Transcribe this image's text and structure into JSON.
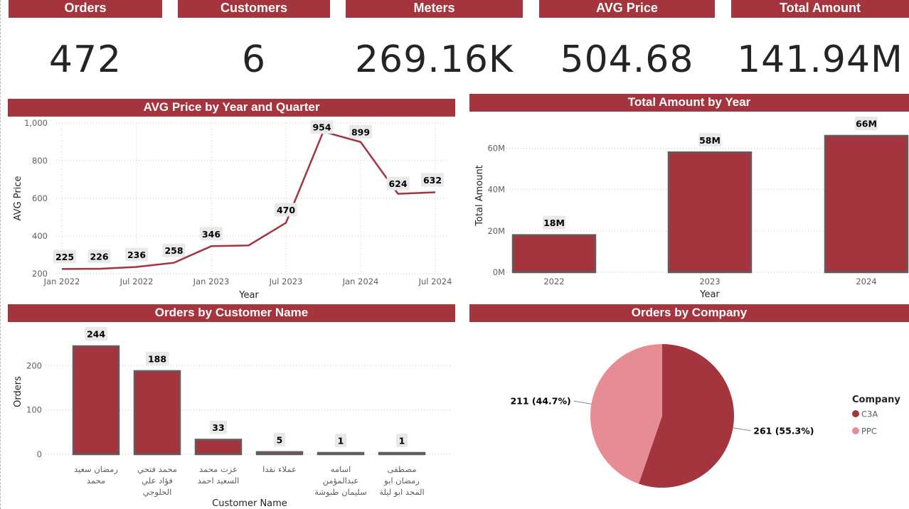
{
  "kpis": [
    {
      "label": "Orders",
      "value": "472"
    },
    {
      "label": "Customers",
      "value": "6"
    },
    {
      "label": "Meters",
      "value": "269.16K"
    },
    {
      "label": "AVG Price",
      "value": "504.68"
    },
    {
      "label": "Total Amount",
      "value": "141.94M"
    }
  ],
  "panels": {
    "avg_price_title": "AVG Price by Year and Quarter",
    "total_amount_title": "Total Amount by Year",
    "orders_customer_title": "Orders by Customer Name",
    "orders_company_title": "Orders by Company"
  },
  "colors": {
    "primary": "#a4343e",
    "secondary": "#e68c94",
    "bar_border": "#605e5c"
  },
  "chart_data": [
    {
      "id": "avg_price",
      "type": "line",
      "title": "AVG Price by Year and Quarter",
      "xlabel": "Year",
      "ylabel": "AVG Price",
      "x_ticks": [
        "Jan 2022",
        "Jul 2022",
        "Jan 2023",
        "Jul 2023",
        "Jan 2024",
        "Jul 2024"
      ],
      "y_ticks": [
        "200",
        "400",
        "600",
        "800",
        "1,000"
      ],
      "ylim": [
        200,
        1000
      ],
      "series": [
        {
          "values": [
            225,
            226,
            236,
            258,
            346,
            350,
            470,
            954,
            899,
            624,
            632
          ]
        }
      ],
      "labels": [
        "225",
        "226",
        "236",
        "258",
        "346",
        "",
        "470",
        "954",
        "899",
        "624",
        "632"
      ],
      "grid": true
    },
    {
      "id": "total_amount",
      "type": "bar",
      "title": "Total Amount by Year",
      "xlabel": "Year",
      "ylabel": "Total Amount",
      "categories": [
        "2022",
        "2023",
        "2024"
      ],
      "values": [
        18,
        58,
        66
      ],
      "labels": [
        "18M",
        "58M",
        "66M"
      ],
      "y_ticks": [
        "0M",
        "20M",
        "40M",
        "60M"
      ],
      "ylim": [
        0,
        66
      ],
      "grid": true
    },
    {
      "id": "orders_customer",
      "type": "bar",
      "title": "Orders by Customer Name",
      "xlabel": "Customer Name",
      "ylabel": "Orders",
      "categories": [
        [
          "رمضان سعيد",
          "محمد"
        ],
        [
          "محمد فتحي",
          "فؤاد علي",
          "الحلوجي"
        ],
        [
          "عزت محمد",
          "السعيد احمد"
        ],
        [
          "عملاء نقدا"
        ],
        [
          "اسامه",
          "عبدالمؤمن",
          "سليمان طبوشة"
        ],
        [
          "مصطفى",
          "رمضان ابو",
          "المجد ابو ليلة"
        ]
      ],
      "values": [
        244,
        188,
        33,
        5,
        1,
        1
      ],
      "labels": [
        "244",
        "188",
        "33",
        "5",
        "1",
        "1"
      ],
      "y_ticks": [
        "0",
        "100",
        "200"
      ],
      "ylim": [
        0,
        244
      ],
      "grid": true
    },
    {
      "id": "orders_company",
      "type": "pie",
      "title": "Orders by Company",
      "legend_title": "Company",
      "legend_position": "right",
      "slices": [
        {
          "name": "C3A",
          "value": 261,
          "label": "261 (55.3%)",
          "color": "#a4343e"
        },
        {
          "name": "PPC",
          "value": 211,
          "label": "211 (44.7%)",
          "color": "#e68c94"
        }
      ]
    }
  ]
}
